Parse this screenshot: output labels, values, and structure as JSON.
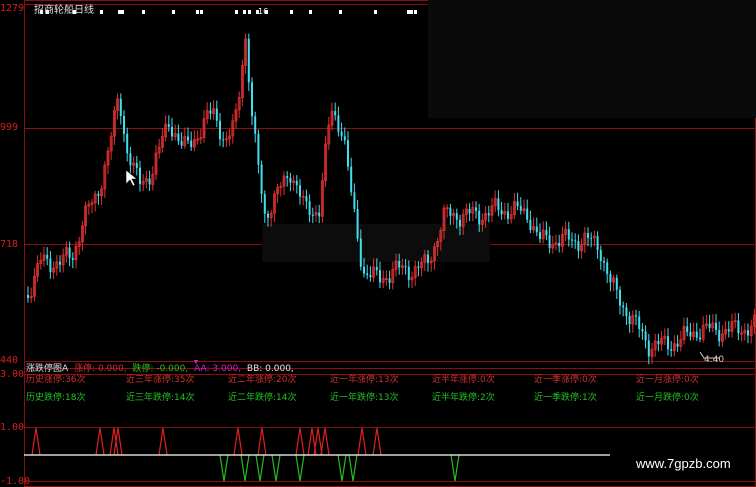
{
  "window": {
    "title": "招商轮船日线"
  },
  "price_axis": {
    "labels": [
      "1279",
      "999",
      "718",
      "440"
    ]
  },
  "indicator_axis": {
    "labels": [
      "3.00",
      "1.00",
      "-1.00"
    ]
  },
  "legend": {
    "name": "涨跌停图A",
    "items": [
      {
        "text": "涨停: 0.000,",
        "color": "#d03030"
      },
      {
        "text": "跌停: -0.000,",
        "color": "#20c020"
      },
      {
        "text": "AA: 3.000,",
        "color": "#d020d0"
      },
      {
        "text": "BB: 0.000,",
        "color": "#e0e0e0"
      }
    ]
  },
  "limit_up_stats": [
    "历史涨停:36次",
    "近三年涨停:35次",
    "近二年涨停:20次",
    "近一年涨停:13次",
    "近半年涨停:0次",
    "近一季涨停:0次",
    "近一月涨停:0次"
  ],
  "limit_down_stats": [
    "历史跌停:18次",
    "近三年跌停:14次",
    "近二年跌停:14次",
    "近一年跌停:13次",
    "近半年跌停:2次",
    "近一季跌停:1次",
    "近一月跌停:0次"
  ],
  "price_annotation": "4.40",
  "top_marker": "16",
  "watermark": "www.7gpzb.com",
  "colors": {
    "up": "#e03030",
    "down": "#40e0f0",
    "grid": "#8a1010",
    "limit_up": "#e02020",
    "limit_down": "#20c020"
  }
}
